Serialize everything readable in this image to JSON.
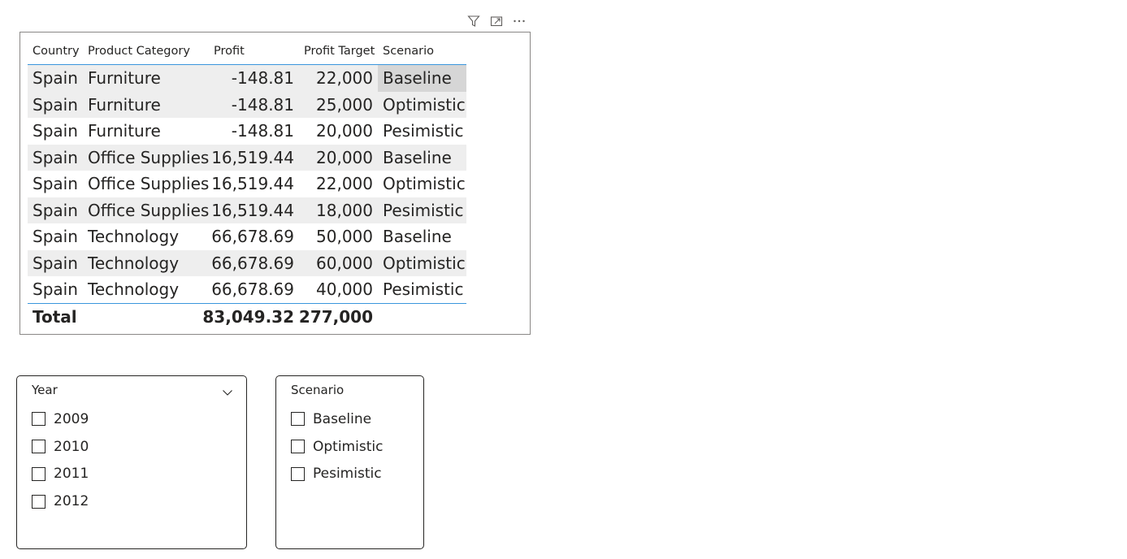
{
  "visual_header": {
    "icons": [
      "filter-icon",
      "focus-mode-icon",
      "more-options-icon"
    ]
  },
  "table": {
    "columns": {
      "country": "Country",
      "category": "Product Category",
      "profit": "Profit",
      "target": "Profit Target",
      "scenario": "Scenario"
    },
    "rows": [
      {
        "country": "Spain",
        "category": "Furniture",
        "profit": "-148.81",
        "target": "22,000",
        "scenario": "Baseline"
      },
      {
        "country": "Spain",
        "category": "Furniture",
        "profit": "-148.81",
        "target": "25,000",
        "scenario": "Optimistic"
      },
      {
        "country": "Spain",
        "category": "Furniture",
        "profit": "-148.81",
        "target": "20,000",
        "scenario": "Pesimistic"
      },
      {
        "country": "Spain",
        "category": "Office Supplies",
        "profit": "16,519.44",
        "target": "20,000",
        "scenario": "Baseline"
      },
      {
        "country": "Spain",
        "category": "Office Supplies",
        "profit": "16,519.44",
        "target": "22,000",
        "scenario": "Optimistic"
      },
      {
        "country": "Spain",
        "category": "Office Supplies",
        "profit": "16,519.44",
        "target": "18,000",
        "scenario": "Pesimistic"
      },
      {
        "country": "Spain",
        "category": "Technology",
        "profit": "66,678.69",
        "target": "50,000",
        "scenario": "Baseline"
      },
      {
        "country": "Spain",
        "category": "Technology",
        "profit": "66,678.69",
        "target": "60,000",
        "scenario": "Optimistic"
      },
      {
        "country": "Spain",
        "category": "Technology",
        "profit": "66,678.69",
        "target": "40,000",
        "scenario": "Pesimistic"
      }
    ],
    "total": {
      "label": "Total",
      "profit": "83,049.32",
      "target": "277,000"
    }
  },
  "slicer_year": {
    "title": "Year",
    "items": [
      "2009",
      "2010",
      "2011",
      "2012"
    ]
  },
  "slicer_scenario": {
    "title": "Scenario",
    "items": [
      "Baseline",
      "Optimistic",
      "Pesimistic"
    ]
  },
  "colors": {
    "accent_line": "#3a96dd",
    "band": "#eeeeee",
    "selected_cell": "#d6d6d6",
    "text": "#252423"
  }
}
